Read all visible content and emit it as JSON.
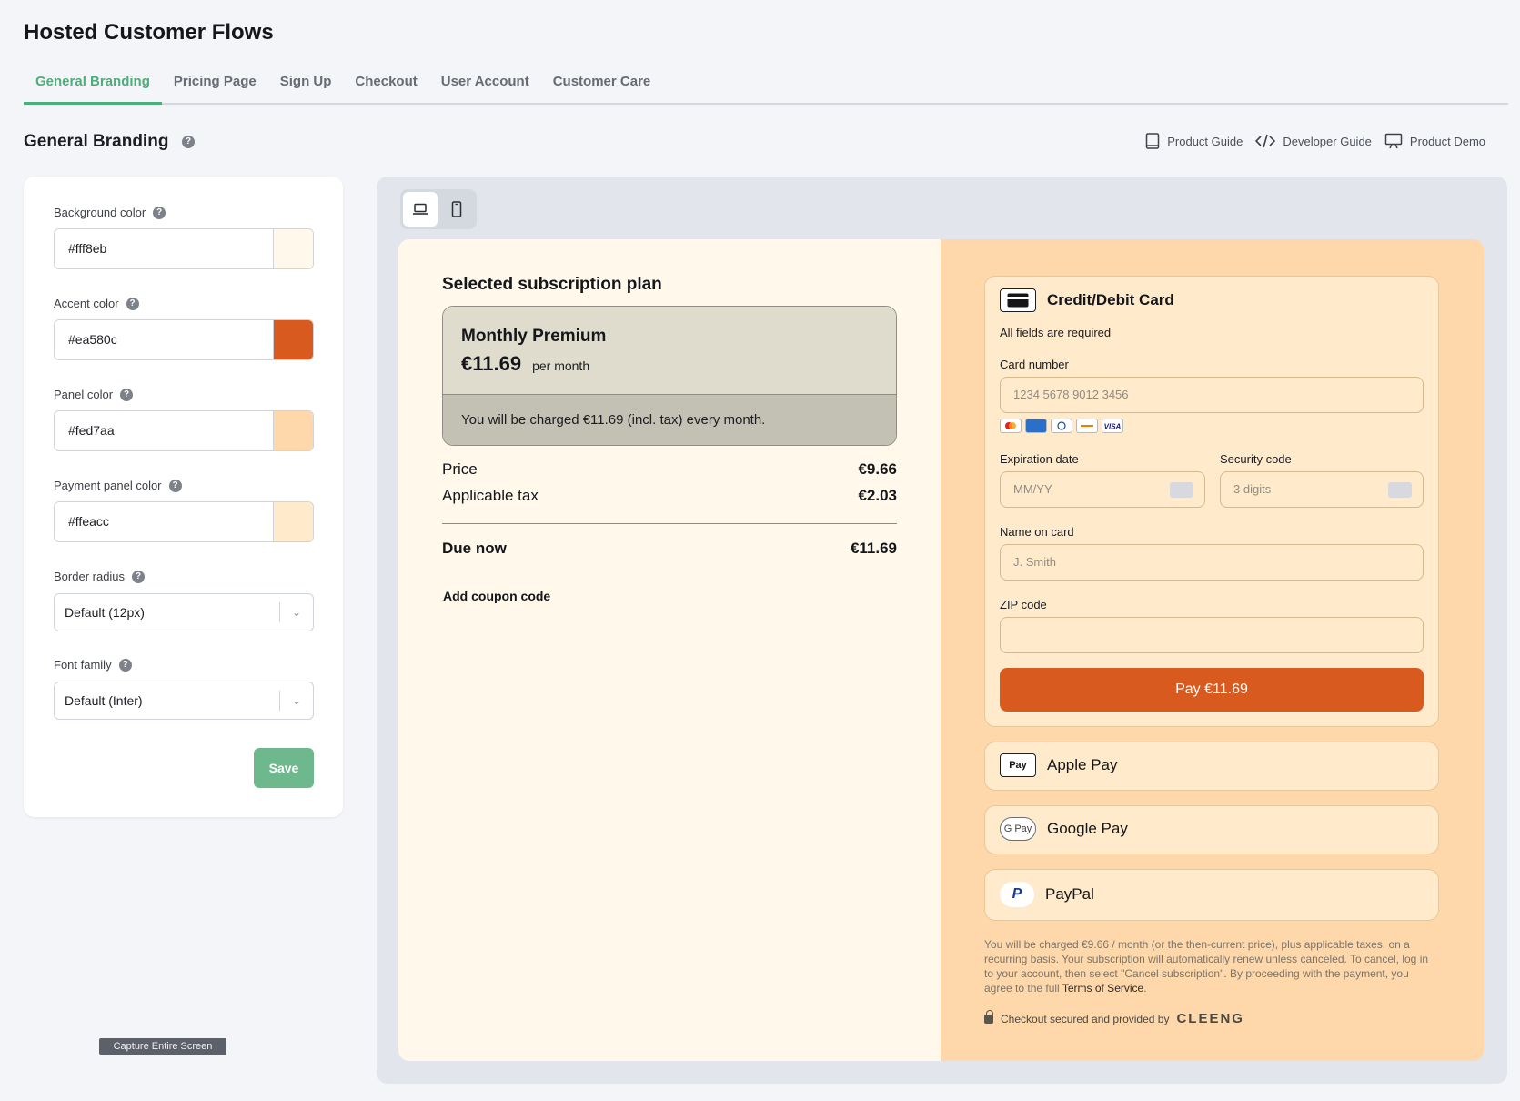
{
  "page_title": "Hosted Customer Flows",
  "tabs": [
    {
      "label": "General Branding"
    },
    {
      "label": "Pricing Page"
    },
    {
      "label": "Sign Up"
    },
    {
      "label": "Checkout"
    },
    {
      "label": "User Account"
    },
    {
      "label": "Customer Care"
    }
  ],
  "section_title": "General Branding",
  "guides": {
    "product_guide": "Product Guide",
    "developer_guide": "Developer Guide",
    "product_demo": "Product Demo"
  },
  "settings": {
    "background": {
      "label": "Background color",
      "value": "#fff8eb"
    },
    "accent": {
      "label": "Accent color",
      "value": "#ea580c"
    },
    "panel": {
      "label": "Panel color",
      "value": "#fed7aa"
    },
    "payment_panel": {
      "label": "Payment panel color",
      "value": "#ffeacc"
    },
    "border_radius": {
      "label": "Border radius",
      "value": "Default (12px)"
    },
    "font_family": {
      "label": "Font family",
      "value": "Default (Inter)"
    },
    "save": "Save"
  },
  "capture_chip": "Capture Entire Screen",
  "checkout": {
    "heading": "Selected subscription plan",
    "plan_name": "Monthly Premium",
    "plan_price": "€11.69",
    "plan_period": "per month",
    "plan_note": "You will be charged €11.69 (incl. tax) every month.",
    "price_label": "Price",
    "price_value": "€9.66",
    "tax_label": "Applicable tax",
    "tax_value": "€2.03",
    "due_label": "Due now",
    "due_value": "€11.69",
    "coupon": "Add coupon code"
  },
  "payment": {
    "card_title": "Credit/Debit Card",
    "required_note": "All fields are required",
    "card_number_label": "Card number",
    "card_number_placeholder": "1234 5678 9012 3456",
    "card_brands": [
      "mastercard",
      "amex",
      "diners",
      "discover",
      "visa"
    ],
    "expiry_label": "Expiration date",
    "expiry_placeholder": "MM/YY",
    "security_label": "Security code",
    "security_placeholder": "3 digits",
    "name_label": "Name on card",
    "name_placeholder": "J. Smith",
    "zip_label": "ZIP code",
    "zip_placeholder": "",
    "pay_button": "Pay €11.69",
    "apple_pay": "Apple Pay",
    "apple_pay_logo": "Pay",
    "google_pay": "Google Pay",
    "google_pay_logo": "G Pay",
    "paypal": "PayPal",
    "paypal_logo": "P",
    "legal_text": "You will be charged €9.66 / month (or the then-current price), plus applicable taxes, on a recurring basis. Your subscription will automatically renew unless canceled. To cancel, log in to your account, then select \"Cancel subscription\". By proceeding with the payment, you agree to the full ",
    "tos_link": "Terms of Service",
    "legal_end": ".",
    "secured_text": "Checkout secured and provided by",
    "provider_logo": "CLEENG"
  },
  "colors": {
    "accent_green": "#4caf7a",
    "background": "#fff8eb",
    "accent": "#ea580c",
    "panel": "#fed7aa",
    "payment_panel": "#ffeacc"
  }
}
